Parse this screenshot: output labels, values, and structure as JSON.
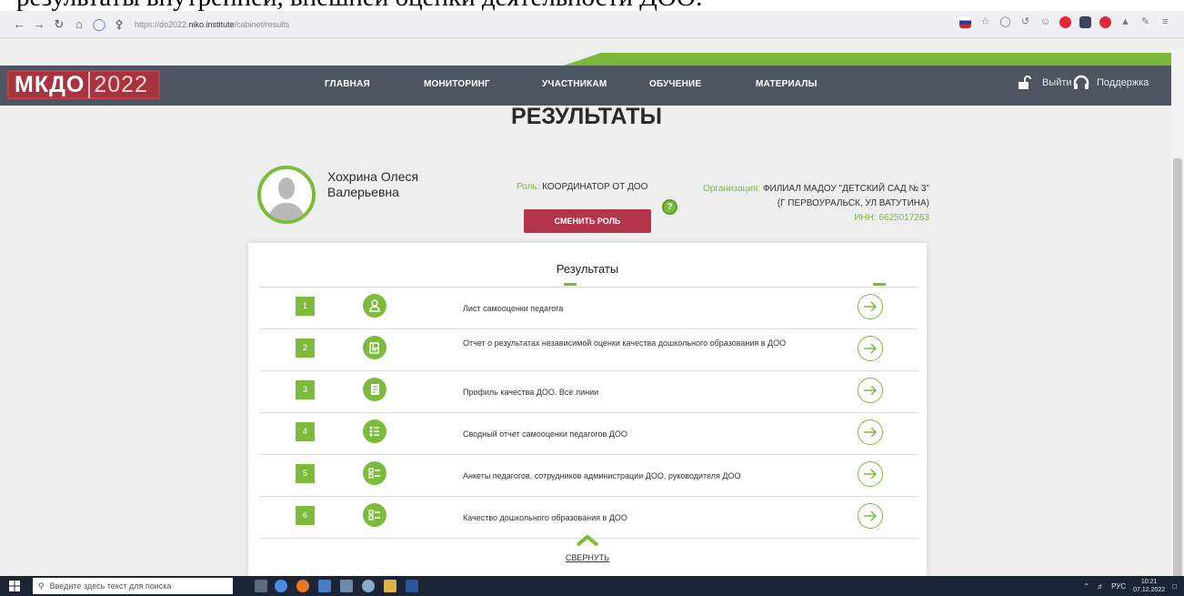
{
  "document_fragment": "результаты внутренней, внешней оценки деятельности ДОО:",
  "browser": {
    "url_prefix": "https://do2022.",
    "url_domain": "niko.institute",
    "url_path": "/cabinet/results",
    "icons": [
      "back-icon",
      "forward-icon",
      "reload-icon",
      "home-icon",
      "shield-icon",
      "lock-icon"
    ]
  },
  "site": {
    "logo_main": "МКДО",
    "logo_year": "2022",
    "menu": [
      "ГЛАВНАЯ",
      "МОНИТОРИНГ",
      "УЧАСТНИКАМ",
      "ОБУЧЕНИЕ",
      "МАТЕРИАЛЫ"
    ],
    "logout": "Выйти",
    "support": "Поддержка",
    "accent": "#7dbb3c",
    "brand": "#a8323e"
  },
  "page": {
    "title": "РЕЗУЛЬТАТЫ",
    "user_name": "Хохрина Олеся Валерьевна",
    "role_label": "Роль:",
    "role_value": "КООРДИНАТОР ОТ ДОО",
    "change_role": "СМЕНИТЬ РОЛЬ",
    "help": "?",
    "org_label": "Организация:",
    "org_value": "ФИЛИАЛ МАДОУ \"ДЕТСКИЙ САД № 3\" (Г ПЕРВОУРАЛЬСК, УЛ ВАТУТИНА)",
    "inn": "ИНН: 6625017263"
  },
  "results": {
    "title": "Результаты",
    "items": [
      {
        "num": "1",
        "text": "Лист самооценки педагога",
        "icon": "user-icon"
      },
      {
        "num": "2",
        "text": "Отчет о результатах независимой оценки качества дошкольного образования в ДОО",
        "icon": "report-icon"
      },
      {
        "num": "3",
        "text": "Профиль качества ДОО. Все линии",
        "icon": "document-icon"
      },
      {
        "num": "4",
        "text": "Сводный отчет самооценки педагогов ДОО",
        "icon": "list-icon"
      },
      {
        "num": "5",
        "text": "Анкеты педагогов, сотрудников администрации ДОО, руководителя ДОО",
        "icon": "checklist-icon"
      },
      {
        "num": "6",
        "text": "Качество дошкольного образования в ДОО",
        "icon": "checklist-icon"
      }
    ],
    "collapse": "СВЕРНУТЬ"
  },
  "taskbar": {
    "search_placeholder": "Введите здесь текст для поиска",
    "lang": "РУС",
    "time": "10:21",
    "date": "07.12.2022"
  }
}
